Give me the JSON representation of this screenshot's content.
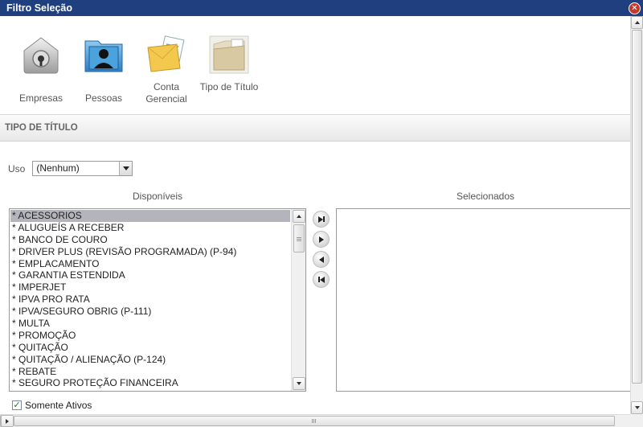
{
  "window": {
    "title": "Filtro Seleção"
  },
  "toolbar": {
    "items": [
      {
        "label": "Empresas",
        "icon": "safe-lock-icon"
      },
      {
        "label": "Pessoas",
        "icon": "person-folder-icon"
      },
      {
        "label": "Conta Gerencial",
        "icon": "documents-icon"
      },
      {
        "label": "Tipo de Título",
        "icon": "folder-documents-icon"
      }
    ]
  },
  "section": {
    "title": "TIPO DE TÍTULO"
  },
  "uso": {
    "label": "Uso",
    "value": "(Nenhum)"
  },
  "disponiveis": {
    "header": "Disponíveis",
    "items": [
      "* ACESSORIOS",
      "* ALUGUEÍS A RECEBER",
      "* BANCO DE COURO",
      "* DRIVER PLUS (REVISÃO PROGRAMADA) (P-94)",
      "* EMPLACAMENTO",
      "* GARANTIA ESTENDIDA",
      "* IMPERJET",
      "* IPVA PRO RATA",
      "* IPVA/SEGURO OBRIG (P-111)",
      "* MULTA",
      "* PROMOÇÃO",
      "* QUITAÇÃO",
      "* QUITAÇÃO / ALIENAÇÃO (P-124)",
      "* REBATE",
      "* SEGURO PROTEÇÃO FINANCEIRA"
    ],
    "selected_index": 0
  },
  "selecionados": {
    "header": "Selecionados",
    "items": []
  },
  "somente_ativos": {
    "label": "Somente Ativos",
    "checked": true
  }
}
